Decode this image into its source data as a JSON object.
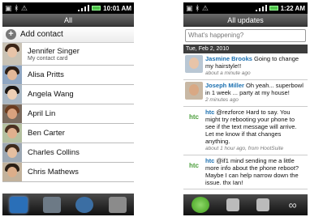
{
  "left": {
    "status": {
      "time": "10:01 AM"
    },
    "title": "All",
    "add_contact": "Add contact",
    "contacts": [
      {
        "name": "Jennifer Singer",
        "sub": "My contact card"
      },
      {
        "name": "Alisa Pritts"
      },
      {
        "name": "Angela Wang"
      },
      {
        "name": "April  Lin"
      },
      {
        "name": "Ben  Carter"
      },
      {
        "name": "Charles  Collins"
      },
      {
        "name": "Chris Mathews"
      }
    ],
    "tabs": [
      "people-tab-icon",
      "groups-tab-icon",
      "online-directory-tab-icon",
      "call-history-tab-icon"
    ]
  },
  "right": {
    "status": {
      "time": "1:22 AM"
    },
    "title": "All updates",
    "compose_placeholder": "What's happening?",
    "date_header": "Tue, Feb 2, 2010",
    "tweets": [
      {
        "author": "Jasmine Brooks",
        "text": " Going to change my hairstyle!!",
        "meta": "about a minute ago"
      },
      {
        "author": "Joseph Miller",
        "text": " Oh yeah... superbowl in 1 week ... party at my house!",
        "meta": "2 minutes ago"
      },
      {
        "author": "htc",
        "text": " @rezforce Hard to say. You might try rebooting your phone to see if the text message will arrive. Let me know if that changes anything.",
        "meta": "about 1 hour ago, from HootSuite"
      },
      {
        "author": "htc",
        "text": " @if1 mind sending me a little more info about the phone reboot? Maybe I can help narrow down the issue. thx Ian!",
        "meta": ""
      }
    ],
    "tabs": [
      "tweets-tab-icon",
      "mentions-tab-icon",
      "messages-tab-icon",
      "search-tab-icon"
    ]
  },
  "colors": {
    "accent": "#1a6fb0",
    "status_bar": "#000000",
    "active_tab": "#2a6fb8"
  }
}
